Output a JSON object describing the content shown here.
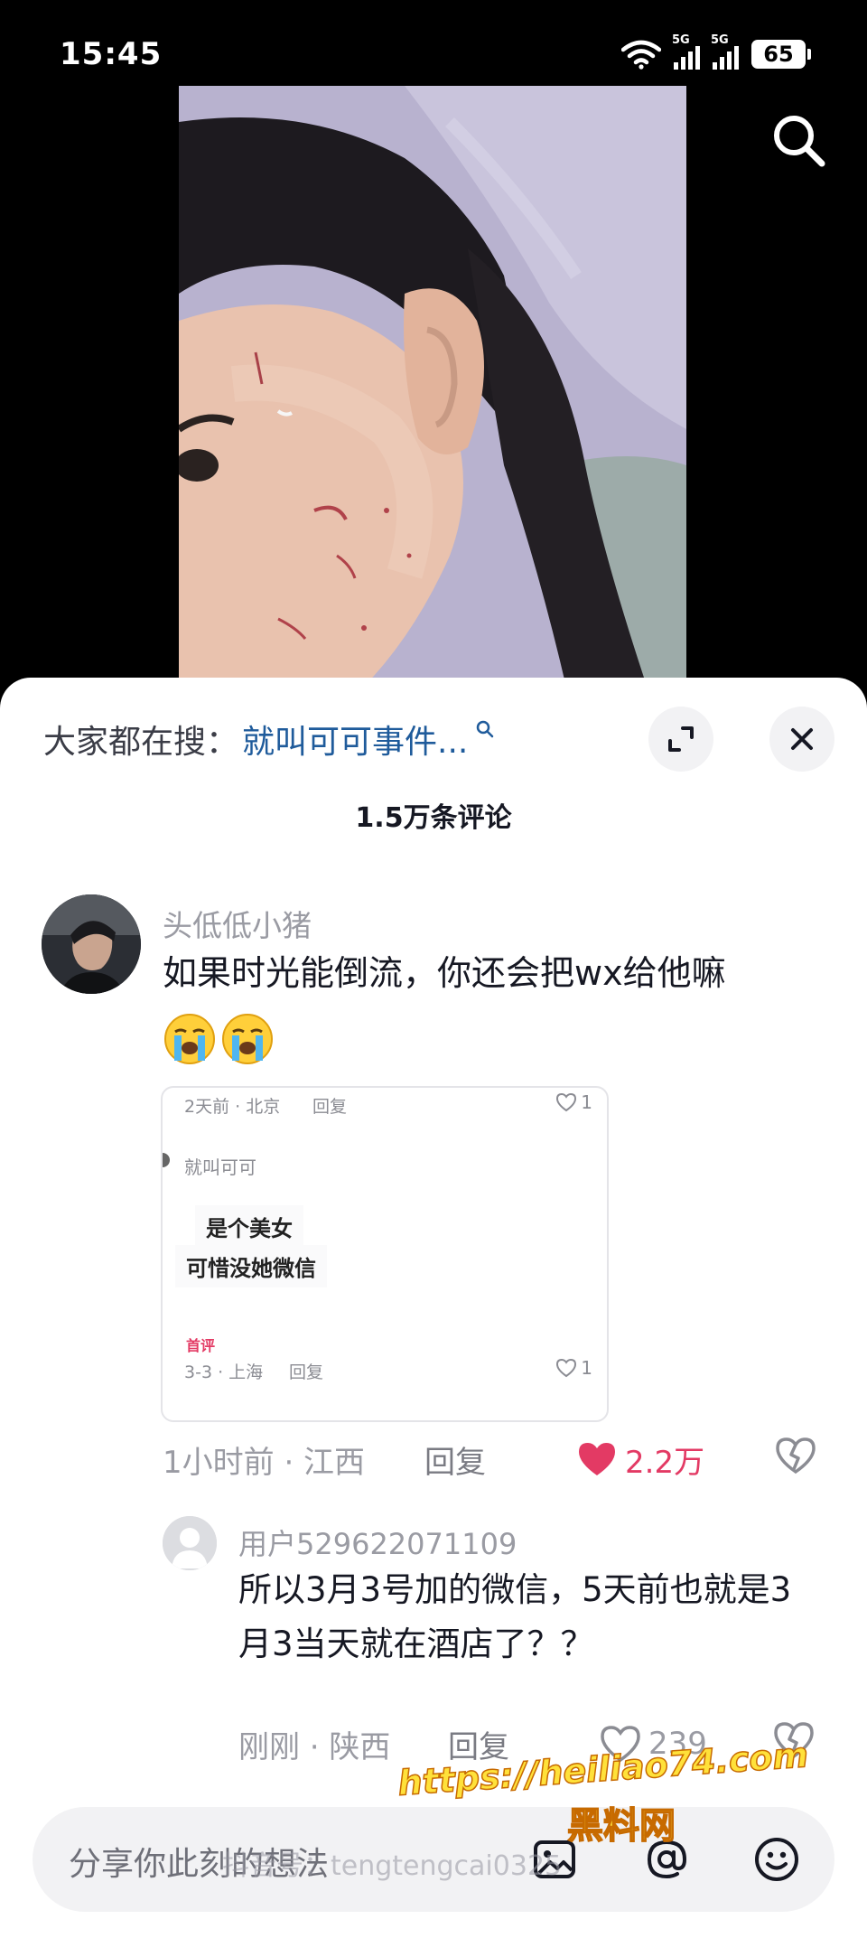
{
  "status_bar": {
    "time": "15:45",
    "network_1": "5G",
    "network_2": "5G",
    "battery": "65"
  },
  "video": {
    "search_icon": "search-icon"
  },
  "comments_sheet": {
    "suggest_label": "大家都在搜：",
    "suggest_query": "就叫可可事件...",
    "title": "1.5万条评论",
    "expand_icon": "expand-icon",
    "close_icon": "close-icon"
  },
  "comment": {
    "author": "头低低小猪",
    "text": "如果时光能倒流，你还会把wx给他嘛",
    "emojis": [
      "crying-face-emoji",
      "crying-face-emoji"
    ],
    "time_location": "1小时前 · 江西",
    "reply": "回复",
    "likes": "2.2万",
    "attached_screenshot": {
      "top_meta": "2天前 · 北京",
      "top_reply": "回复",
      "top_likes": "1",
      "name": "就叫可可",
      "line1": "是个美女",
      "line2": "可惜没她微信",
      "badge": "首评",
      "bottom_meta": "3-3 · 上海",
      "bottom_reply": "回复",
      "bottom_likes": "1"
    }
  },
  "sub_reply": {
    "author": "用户529622071109",
    "text": "所以3月3号加的微信，5天前也就是3月3当天就在酒店了？？",
    "time_location": "刚刚 · 陕西",
    "reply": "回复",
    "likes": "239"
  },
  "composer": {
    "placeholder": "分享你此刻的想法"
  },
  "watermarks": {
    "handle": "抖音号：tengtengcai0325",
    "url": "https://heiliao74.com",
    "site": "黑料网"
  },
  "colors": {
    "accent_like": "#e33a64",
    "link": "#1f5b9b",
    "muted_text": "#9a9ba3"
  }
}
